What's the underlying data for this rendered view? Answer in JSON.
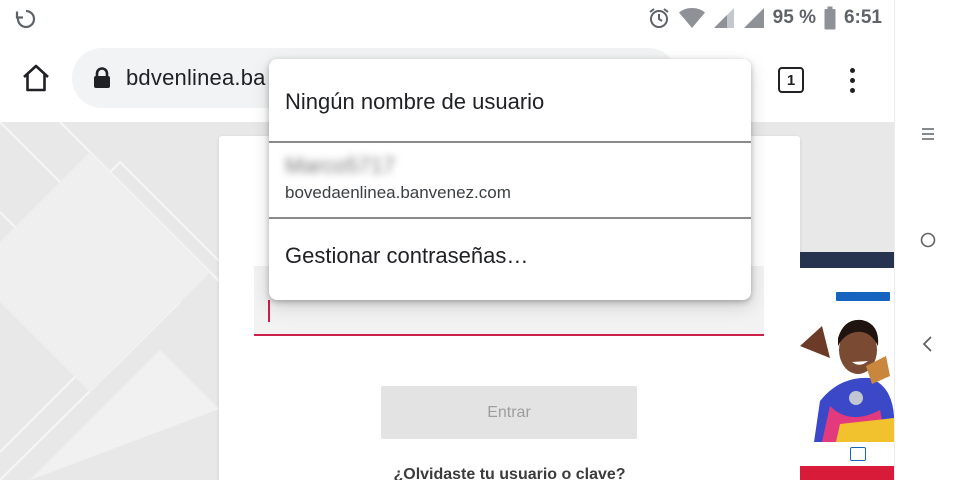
{
  "status_bar": {
    "battery_text": "95 %",
    "time": "6:51",
    "icons": [
      "rotate-icon",
      "alarm-icon",
      "wifi-icon",
      "signal-icon",
      "signal-icon",
      "battery-icon"
    ]
  },
  "toolbar": {
    "url": "bdvenlinea.ba",
    "tab_count": "1",
    "icons": [
      "home-icon",
      "lock-icon",
      "menu-dots-icon"
    ]
  },
  "login": {
    "enter_label": "Entrar",
    "forgot_link": "¿Olvidaste tu usuario o clave?"
  },
  "autofill": {
    "no_username_label": "Ningún nombre de usuario",
    "saved_username": "Marco5717",
    "saved_domain": "bovedaenlinea.banvenez.com",
    "manage_label": "Gestionar contraseñas…"
  },
  "navbar": {
    "icons": [
      "recents-icon",
      "home-circle-icon",
      "back-icon"
    ]
  },
  "colors": {
    "accent": "#cc1f4a",
    "text": "#202124",
    "omnibox_bg": "#f1f3f4"
  }
}
